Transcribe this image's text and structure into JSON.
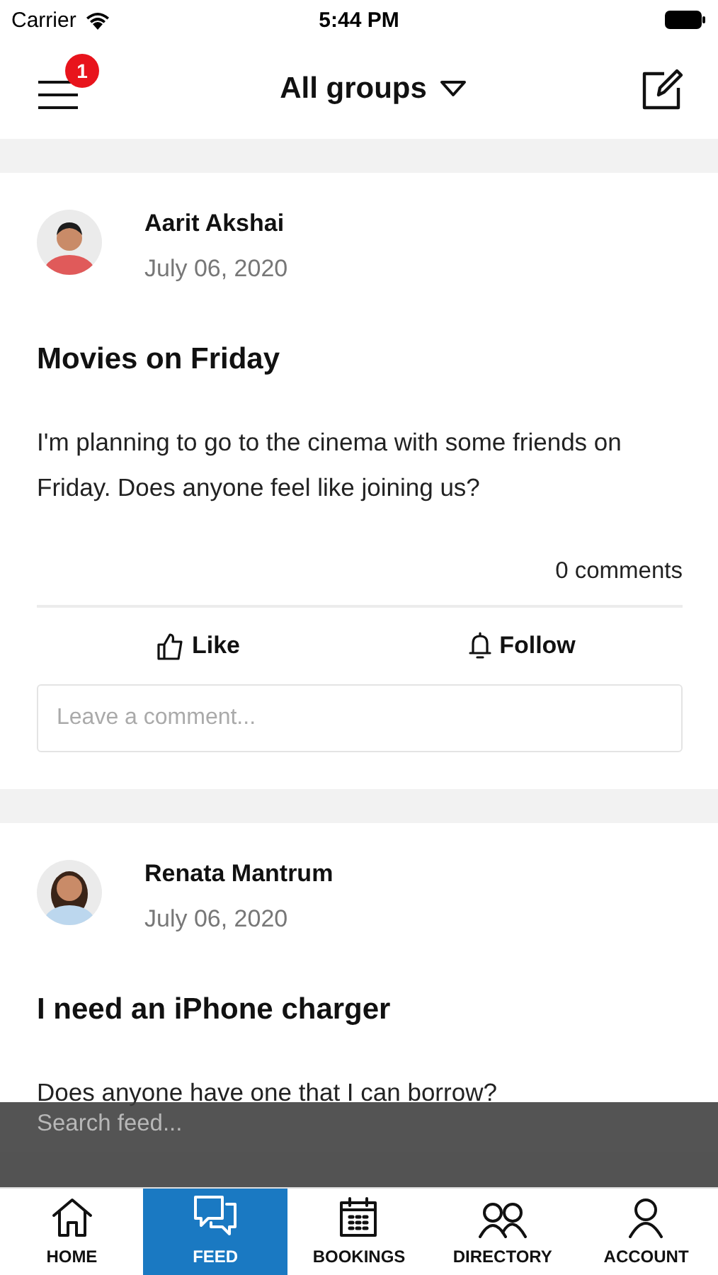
{
  "status_bar": {
    "carrier": "Carrier",
    "time": "5:44 PM"
  },
  "header": {
    "menu_badge": "1",
    "title": "All groups"
  },
  "posts": [
    {
      "author": "Aarit Akshai",
      "date": "July 06, 2020",
      "title": "Movies on Friday",
      "body": "I'm planning to go to the cinema with some friends on Friday. Does anyone feel like joining us?",
      "comments": "0 comments",
      "actions": [
        {
          "kind": "like",
          "label": "Like"
        },
        {
          "kind": "follow",
          "label": "Follow"
        }
      ],
      "comment_placeholder": "Leave a comment..."
    },
    {
      "author": "Renata Mantrum",
      "date": "July 06, 2020",
      "title": "I need an iPhone charger",
      "body": "Does anyone have one that I can borrow?"
    }
  ],
  "search": {
    "placeholder": "Search feed..."
  },
  "tabs": [
    {
      "kind": "home",
      "label": "HOME",
      "selected": false
    },
    {
      "kind": "feed",
      "label": "FEED",
      "selected": true
    },
    {
      "kind": "bookings",
      "label": "BOOKINGS",
      "selected": false
    },
    {
      "kind": "directory",
      "label": "DIRECTORY",
      "selected": false
    },
    {
      "kind": "account",
      "label": "ACCOUNT",
      "selected": false
    }
  ]
}
